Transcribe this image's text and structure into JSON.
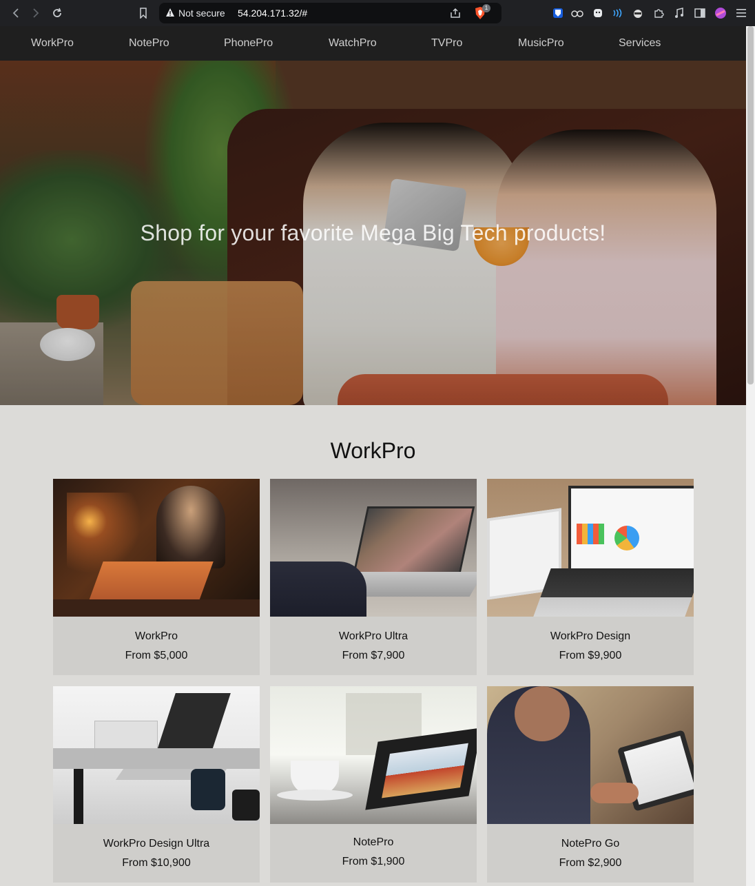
{
  "browser": {
    "security_label": "Not secure",
    "url": "54.204.171.32/#",
    "shields_count": "1"
  },
  "nav": {
    "items": [
      "WorkPro",
      "NotePro",
      "PhonePro",
      "WatchPro",
      "TVPro",
      "MusicPro",
      "Services"
    ]
  },
  "hero": {
    "headline": "Shop for your favorite Mega Big Tech products!"
  },
  "section": {
    "title": "WorkPro",
    "products": [
      {
        "name": "WorkPro",
        "price": "From $5,000"
      },
      {
        "name": "WorkPro Ultra",
        "price": "From $7,900"
      },
      {
        "name": "WorkPro Design",
        "price": "From $9,900"
      },
      {
        "name": "WorkPro Design Ultra",
        "price": "From $10,900"
      },
      {
        "name": "NotePro",
        "price": "From $1,900"
      },
      {
        "name": "NotePro Go",
        "price": "From $2,900"
      }
    ]
  },
  "colors": {
    "nav_bg": "#1f1f1f",
    "page_bg": "#dcdbd8",
    "card_bg": "#cfcecb",
    "chrome_bg": "#202124"
  }
}
